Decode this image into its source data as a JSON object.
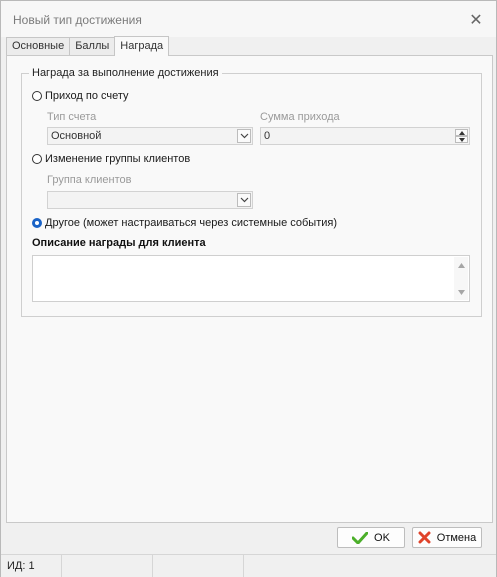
{
  "window": {
    "title": "Новый тип достижения",
    "close_glyph": "✕"
  },
  "tabs": [
    {
      "label": "Основные",
      "active": false
    },
    {
      "label": "Баллы",
      "active": false
    },
    {
      "label": "Награда",
      "active": true
    }
  ],
  "reward": {
    "group_title": "Награда за выполнение достижения",
    "options": {
      "account_income": {
        "label": "Приход по счету",
        "selected": false,
        "account_type_label": "Тип счета",
        "account_type_value": "Основной",
        "amount_label": "Сумма прихода",
        "amount_value": "0"
      },
      "client_group_change": {
        "label": "Изменение группы клиентов",
        "selected": false,
        "client_group_label": "Группа клиентов",
        "client_group_value": ""
      },
      "other": {
        "label": "Другое (может настраиваться через системные события)",
        "selected": true
      }
    },
    "description_label": "Описание награды для клиента",
    "description_value": ""
  },
  "buttons": {
    "ok_label": "OK",
    "cancel_label": "Отмена"
  },
  "status": {
    "id_text": "ИД: 1"
  },
  "colors": {
    "accent": "#1a63c7",
    "ok_icon": "#4caf2a",
    "cancel_icon": "#e0432a"
  },
  "icons": {
    "ok": "check-icon",
    "cancel": "cross-icon",
    "dropdown": "chevron-down-icon"
  }
}
